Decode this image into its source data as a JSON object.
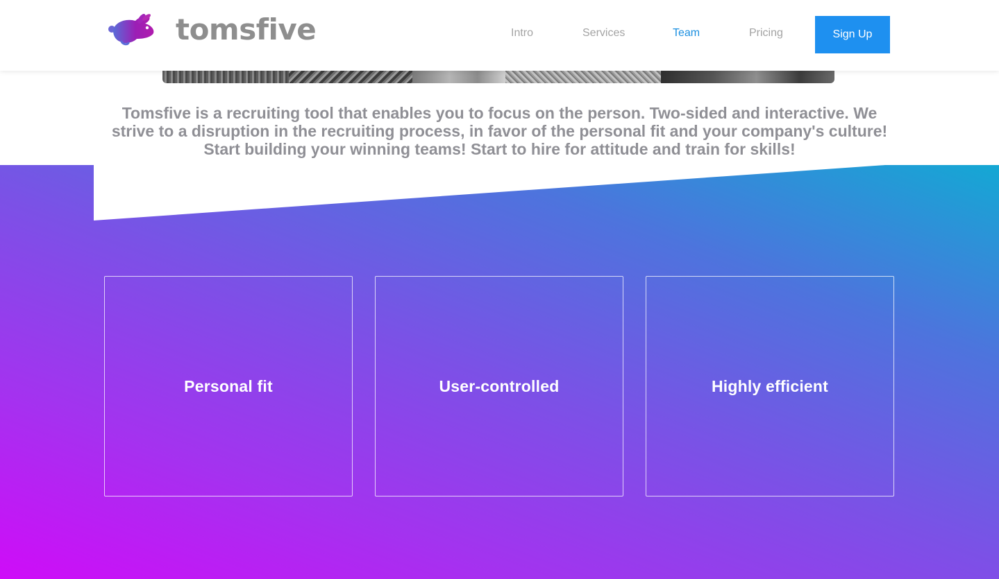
{
  "brand": {
    "name": "tomsfive",
    "logo_icon": "rabbit-icon",
    "logo_colors": [
      "#9b1fb5",
      "#5a6cd8"
    ]
  },
  "nav": {
    "items": [
      {
        "label": "Intro",
        "active": false
      },
      {
        "label": "Services",
        "active": false
      },
      {
        "label": "Team",
        "active": true
      },
      {
        "label": "Pricing",
        "active": false
      }
    ],
    "signup_label": "Sign Up"
  },
  "intro": {
    "text": "Tomsfive is a recruiting tool that enables you to focus on the person. Two-sided and interactive. We strive to a disruption in the recruiting process, in favor of the personal fit and your company's culture! Start building your winning teams! Start to hire for attitude and train for skills!"
  },
  "features": {
    "cards": [
      {
        "title": "Personal fit"
      },
      {
        "title": "User-controlled"
      },
      {
        "title": "Highly efficient"
      }
    ]
  },
  "colors": {
    "accent": "#1e90f0",
    "active_nav": "#1b8fe0",
    "muted_text": "#8f8f95",
    "gradient_start": "#cf0cf8",
    "gradient_end": "#14a8d4"
  }
}
